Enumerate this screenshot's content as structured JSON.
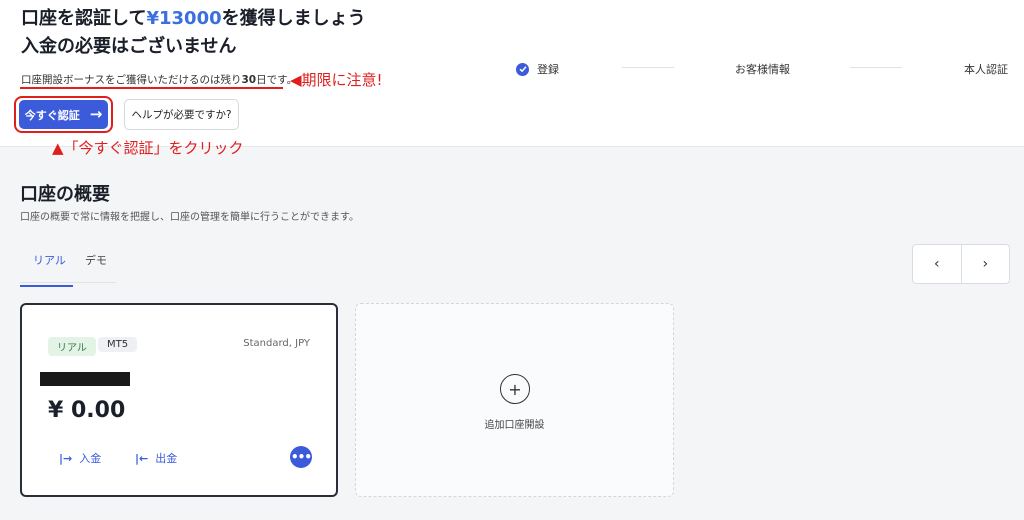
{
  "header": {
    "headline_prefix": "口座を認証して",
    "headline_amount": "¥13000",
    "headline_suffix": "を獲得しましょう",
    "headline_line2": "入金の必要はございません",
    "notice_prefix": "口座開設ボーナスをご獲得いただけるのは残り",
    "notice_days": "30",
    "notice_suffix": "日です。",
    "verify_button": "今すぐ認証",
    "help_button": "ヘルプが必要ですか?"
  },
  "annotations": {
    "deadline_note": "◀期限に注意!",
    "click_note": "▲「今すぐ認証」をクリック"
  },
  "steps": [
    "登録",
    "お客様情報",
    "本人認証"
  ],
  "overview": {
    "title": "口座の概要",
    "subtitle": "口座の概要で常に情報を把握し、口座の管理を簡単に行うことができます。",
    "tabs": [
      "リアル",
      "デモ"
    ],
    "pager_prev": "‹",
    "pager_next": "›"
  },
  "account_card": {
    "badge_type": "リアル",
    "badge_platform": "MT5",
    "account_type": "Standard, JPY",
    "balance": "¥ 0.00",
    "deposit_icon": "|→",
    "deposit_label": "入金",
    "withdraw_icon": "|←",
    "withdraw_label": "出金",
    "more_icon": "•••"
  },
  "add_card": {
    "plus": "+",
    "label": "追加口座開設"
  },
  "colors": {
    "accent": "#3b5bdb",
    "headline_amount": "#3b6fe0",
    "annotation_red": "#e01e1e",
    "badge_green_bg": "#e3f3e6"
  }
}
